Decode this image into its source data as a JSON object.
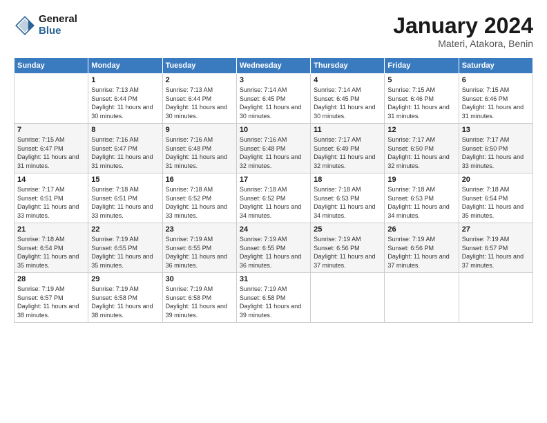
{
  "header": {
    "logo_general": "General",
    "logo_blue": "Blue",
    "month_title": "January 2024",
    "location": "Materi, Atakora, Benin"
  },
  "days_of_week": [
    "Sunday",
    "Monday",
    "Tuesday",
    "Wednesday",
    "Thursday",
    "Friday",
    "Saturday"
  ],
  "weeks": [
    [
      {
        "day": "",
        "info": ""
      },
      {
        "day": "1",
        "info": "Sunrise: 7:13 AM\nSunset: 6:44 PM\nDaylight: 11 hours\nand 30 minutes."
      },
      {
        "day": "2",
        "info": "Sunrise: 7:13 AM\nSunset: 6:44 PM\nDaylight: 11 hours\nand 30 minutes."
      },
      {
        "day": "3",
        "info": "Sunrise: 7:14 AM\nSunset: 6:45 PM\nDaylight: 11 hours\nand 30 minutes."
      },
      {
        "day": "4",
        "info": "Sunrise: 7:14 AM\nSunset: 6:45 PM\nDaylight: 11 hours\nand 30 minutes."
      },
      {
        "day": "5",
        "info": "Sunrise: 7:15 AM\nSunset: 6:46 PM\nDaylight: 11 hours\nand 31 minutes."
      },
      {
        "day": "6",
        "info": "Sunrise: 7:15 AM\nSunset: 6:46 PM\nDaylight: 11 hours\nand 31 minutes."
      }
    ],
    [
      {
        "day": "7",
        "info": "Sunrise: 7:15 AM\nSunset: 6:47 PM\nDaylight: 11 hours\nand 31 minutes."
      },
      {
        "day": "8",
        "info": "Sunrise: 7:16 AM\nSunset: 6:47 PM\nDaylight: 11 hours\nand 31 minutes."
      },
      {
        "day": "9",
        "info": "Sunrise: 7:16 AM\nSunset: 6:48 PM\nDaylight: 11 hours\nand 31 minutes."
      },
      {
        "day": "10",
        "info": "Sunrise: 7:16 AM\nSunset: 6:48 PM\nDaylight: 11 hours\nand 32 minutes."
      },
      {
        "day": "11",
        "info": "Sunrise: 7:17 AM\nSunset: 6:49 PM\nDaylight: 11 hours\nand 32 minutes."
      },
      {
        "day": "12",
        "info": "Sunrise: 7:17 AM\nSunset: 6:50 PM\nDaylight: 11 hours\nand 32 minutes."
      },
      {
        "day": "13",
        "info": "Sunrise: 7:17 AM\nSunset: 6:50 PM\nDaylight: 11 hours\nand 33 minutes."
      }
    ],
    [
      {
        "day": "14",
        "info": "Sunrise: 7:17 AM\nSunset: 6:51 PM\nDaylight: 11 hours\nand 33 minutes."
      },
      {
        "day": "15",
        "info": "Sunrise: 7:18 AM\nSunset: 6:51 PM\nDaylight: 11 hours\nand 33 minutes."
      },
      {
        "day": "16",
        "info": "Sunrise: 7:18 AM\nSunset: 6:52 PM\nDaylight: 11 hours\nand 33 minutes."
      },
      {
        "day": "17",
        "info": "Sunrise: 7:18 AM\nSunset: 6:52 PM\nDaylight: 11 hours\nand 34 minutes."
      },
      {
        "day": "18",
        "info": "Sunrise: 7:18 AM\nSunset: 6:53 PM\nDaylight: 11 hours\nand 34 minutes."
      },
      {
        "day": "19",
        "info": "Sunrise: 7:18 AM\nSunset: 6:53 PM\nDaylight: 11 hours\nand 34 minutes."
      },
      {
        "day": "20",
        "info": "Sunrise: 7:18 AM\nSunset: 6:54 PM\nDaylight: 11 hours\nand 35 minutes."
      }
    ],
    [
      {
        "day": "21",
        "info": "Sunrise: 7:18 AM\nSunset: 6:54 PM\nDaylight: 11 hours\nand 35 minutes."
      },
      {
        "day": "22",
        "info": "Sunrise: 7:19 AM\nSunset: 6:55 PM\nDaylight: 11 hours\nand 35 minutes."
      },
      {
        "day": "23",
        "info": "Sunrise: 7:19 AM\nSunset: 6:55 PM\nDaylight: 11 hours\nand 36 minutes."
      },
      {
        "day": "24",
        "info": "Sunrise: 7:19 AM\nSunset: 6:55 PM\nDaylight: 11 hours\nand 36 minutes."
      },
      {
        "day": "25",
        "info": "Sunrise: 7:19 AM\nSunset: 6:56 PM\nDaylight: 11 hours\nand 37 minutes."
      },
      {
        "day": "26",
        "info": "Sunrise: 7:19 AM\nSunset: 6:56 PM\nDaylight: 11 hours\nand 37 minutes."
      },
      {
        "day": "27",
        "info": "Sunrise: 7:19 AM\nSunset: 6:57 PM\nDaylight: 11 hours\nand 37 minutes."
      }
    ],
    [
      {
        "day": "28",
        "info": "Sunrise: 7:19 AM\nSunset: 6:57 PM\nDaylight: 11 hours\nand 38 minutes."
      },
      {
        "day": "29",
        "info": "Sunrise: 7:19 AM\nSunset: 6:58 PM\nDaylight: 11 hours\nand 38 minutes."
      },
      {
        "day": "30",
        "info": "Sunrise: 7:19 AM\nSunset: 6:58 PM\nDaylight: 11 hours\nand 39 minutes."
      },
      {
        "day": "31",
        "info": "Sunrise: 7:19 AM\nSunset: 6:58 PM\nDaylight: 11 hours\nand 39 minutes."
      },
      {
        "day": "",
        "info": ""
      },
      {
        "day": "",
        "info": ""
      },
      {
        "day": "",
        "info": ""
      }
    ]
  ]
}
